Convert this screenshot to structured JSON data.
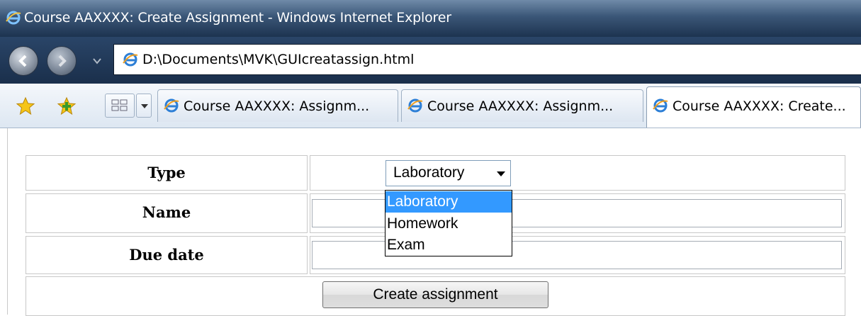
{
  "window": {
    "title": "Course AAXXXX: Create Assignment - Windows Internet Explorer",
    "address": "D:\\Documents\\MVK\\GUIcreatassign.html"
  },
  "toolbar": {
    "favorites_icon": "favorites-star-icon",
    "add_favorites_icon": "add-favorites-icon",
    "quick_tabs_icon": "quick-tabs-grid-icon"
  },
  "tabs": [
    {
      "label": "Course AAXXXX: Assignm...",
      "active": false
    },
    {
      "label": "Course AAXXXX: Assignm...",
      "active": false
    },
    {
      "label": "Course AAXXXX: Create...",
      "active": true
    }
  ],
  "form": {
    "type_label": "Type",
    "name_label": "Name",
    "due_label": "Due date",
    "type_selected": "Laboratory",
    "type_options": [
      "Laboratory",
      "Homework",
      "Exam"
    ],
    "name_value": "",
    "due_value": "",
    "submit_label": "Create assignment"
  },
  "colors": {
    "highlight": "#3399ff",
    "titlebar": "#1d3350"
  }
}
